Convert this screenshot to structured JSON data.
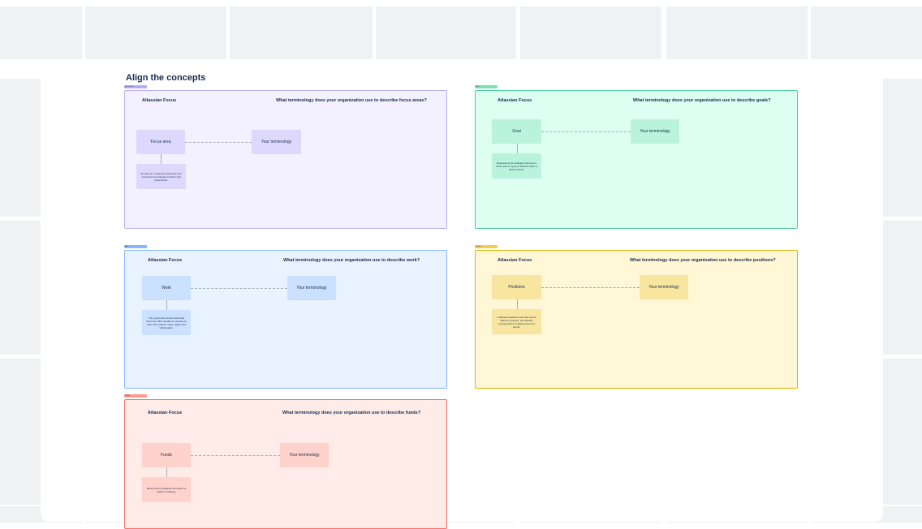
{
  "board": {
    "title": "Align the concepts"
  },
  "frames": [
    {
      "id": "focus-areas",
      "tag": "Focus area",
      "left_title": "Atlassian Focus",
      "question": "What terminology does your organization use to describe focus areas?",
      "concept": "Focus area",
      "your_term": "Your terminology",
      "description": "An area of a company's business that represents its strategic priorities and investments.",
      "colors": {
        "bg": "#f3f0ff",
        "border": "#b8acf6",
        "box": "#dfd8fd",
        "tag": "#b8acf6"
      }
    },
    {
      "id": "goals",
      "tag": "Goal",
      "left_title": "Atlassian Focus",
      "question": "What terminology does your organization use to describe goals?",
      "concept": "Goal",
      "your_term": "Your terminology",
      "description": "Represents the strategic outcomes a focus area is trying to achieve within a period of time.",
      "colors": {
        "bg": "#dcfff1",
        "border": "#4bce97",
        "box": "#baf3db",
        "tag": "#7ee2b8"
      }
    },
    {
      "id": "work",
      "tag": "Work",
      "left_title": "Atlassian Focus",
      "question": "What terminology does your organization use to describe work?",
      "concept": "Work",
      "your_term": "Your terminology",
      "description": "The project-like assets that break down the effort needed to execute an idea, like projects, epics, pages and whiteboards.",
      "colors": {
        "bg": "#e9f2ff",
        "border": "#85b8ff",
        "box": "#cce0ff",
        "tag": "#85b8ff"
      }
    },
    {
      "id": "positions",
      "tag": "Position",
      "left_title": "Atlassian Focus",
      "question": "What terminology does your organization use to describe positions?",
      "concept": "Positions",
      "your_term": "Your terminology",
      "description": "A defined headcount slot that can be filled by a person, and directly corresponds to a dollar amount of spend.",
      "colors": {
        "bg": "#fff7d6",
        "border": "#e2b203",
        "box": "#f8e6a0",
        "tag": "#f5cd47"
      }
    },
    {
      "id": "funds",
      "tag": "Funds",
      "left_title": "Atlassian Focus",
      "question": "What terminology does your organization use to describe funds?",
      "concept": "Funds",
      "your_term": "Your terminology",
      "description": "Money that is budgeted and spent to deliver a strategy.",
      "colors": {
        "bg": "#ffece8",
        "border": "#f87168",
        "box": "#ffd2cc",
        "tag": "#fd9891"
      }
    }
  ]
}
